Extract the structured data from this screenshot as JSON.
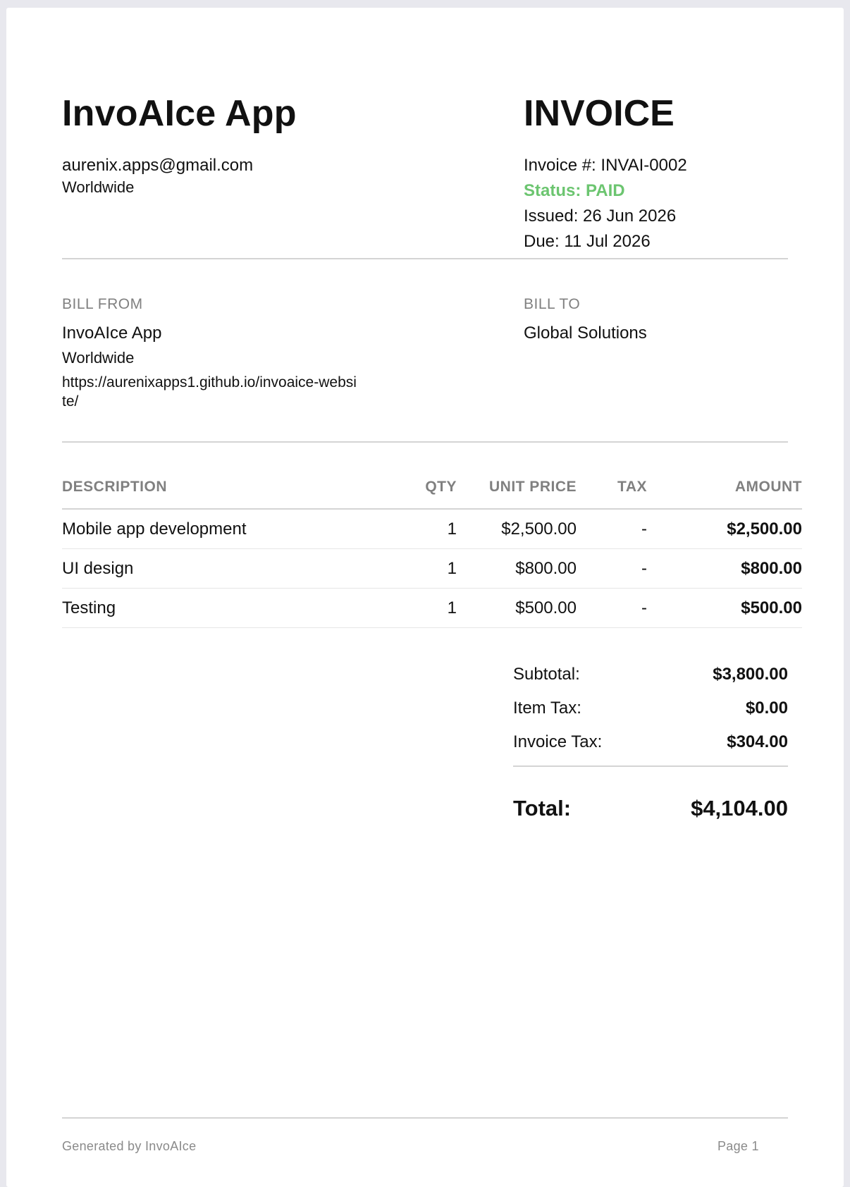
{
  "header": {
    "company_name": "InvoAIce App",
    "company_email": "aurenix.apps@gmail.com",
    "company_region": "Worldwide",
    "title": "INVOICE",
    "invoice_number": "Invoice #: INVAI-0002",
    "status": "Status: PAID",
    "issued": "Issued: 26 Jun 2026",
    "due": "Due: 11 Jul 2026",
    "status_color": "#6cc570"
  },
  "bill_from": {
    "label": "BILL FROM",
    "name": "InvoAIce App",
    "region": "Worldwide",
    "url": "https://aurenixapps1.github.io/invoaice-website/"
  },
  "bill_to": {
    "label": "BILL TO",
    "name": "Global Solutions"
  },
  "table": {
    "columns": [
      "DESCRIPTION",
      "QTY",
      "UNIT PRICE",
      "TAX",
      "AMOUNT"
    ],
    "rows": [
      {
        "description": "Mobile app development",
        "qty": "1",
        "unit_price": "$2,500.00",
        "tax": "-",
        "amount": "$2,500.00"
      },
      {
        "description": "UI design",
        "qty": "1",
        "unit_price": "$800.00",
        "tax": "-",
        "amount": "$800.00"
      },
      {
        "description": "Testing",
        "qty": "1",
        "unit_price": "$500.00",
        "tax": "-",
        "amount": "$500.00"
      }
    ]
  },
  "totals": {
    "subtotal_label": "Subtotal:",
    "subtotal_value": "$3,800.00",
    "item_tax_label": "Item Tax:",
    "item_tax_value": "$0.00",
    "invoice_tax_label": "Invoice Tax:",
    "invoice_tax_value": "$304.00",
    "total_label": "Total:",
    "total_value": "$4,104.00"
  },
  "footer": {
    "generated_by": "Generated by InvoAIce",
    "page": "Page 1"
  }
}
